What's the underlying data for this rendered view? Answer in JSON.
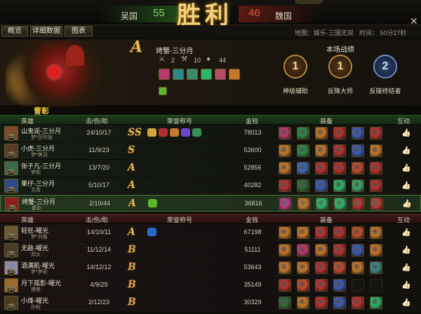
{
  "header": {
    "team_left": "吴国",
    "score_left": "55",
    "team_right": "魏国",
    "score_right": "46",
    "result": "胜利",
    "close_icon": "close-icon"
  },
  "tabs": [
    "概览",
    "详细数据",
    "图表"
  ],
  "meta": {
    "map": "地图：娱乐·三国无双",
    "time": "时间：  50分27秒"
  },
  "hero": {
    "grade": "A",
    "name": "烤蟹-三分月",
    "kills_icon": "swords-icon",
    "kills": "2",
    "assists_icon": "crossed-axes-icon",
    "assists": "10",
    "gold_icon": "gold-pile-icon",
    "gold": "44",
    "title_icon": "honor-badge-icon",
    "player_label": "曹彰"
  },
  "performance": {
    "title": "本场战绩",
    "medals": [
      {
        "label": "神级辅助",
        "mark": "1"
      },
      {
        "label": "反降大师",
        "mark": "1"
      },
      {
        "label": "反陵终结者",
        "mark": "2"
      }
    ]
  },
  "columns": {
    "hero": "英雄",
    "kda": "击/伤/助",
    "honor": "荣誉称号",
    "gold": "金钱",
    "equip": "装备",
    "interact": "互动"
  },
  "team_a": [
    {
      "name": "山鬼谣-三分月",
      "level": "25",
      "player": "梦*莎玲珑",
      "kda": "24/10/17",
      "grade": "SS",
      "gold": "78013",
      "avatar": "#7a4a2a",
      "badges": [
        "#d6a43a",
        "#b82e2e",
        "#c77a2a",
        "#6a4ac8",
        "#3a8a5a"
      ]
    },
    {
      "name": "小虎-三分月",
      "level": "25",
      "player": "梦*美羽",
      "kda": "11/9/23",
      "grade": "S",
      "gold": "53600",
      "avatar": "#5a3a2a",
      "badges": []
    },
    {
      "name": "张子凡-三分月",
      "level": "25",
      "player": "梦莉",
      "kda": "13/7/20",
      "grade": "A",
      "gold": "52856",
      "avatar": "#3a6a4a",
      "badges": []
    },
    {
      "name": "果仔-三分月",
      "level": "25",
      "player": "文青",
      "kda": "5/10/17",
      "grade": "A",
      "gold": "40282",
      "avatar": "#2a4a8a",
      "badges": []
    },
    {
      "name": "烤蟹-三分月",
      "level": "25",
      "player": "曹彰",
      "kda": "2/10/44",
      "grade": "A",
      "gold": "36816",
      "avatar": "#8a2020",
      "badges": [
        "#5ab82a"
      ]
    }
  ],
  "team_b": [
    {
      "name": "轻狂-曜光",
      "level": "25",
      "player": "梦*刘备",
      "kda": "14/10/11",
      "grade": "A",
      "gold": "67198",
      "avatar": "#6a5a3a",
      "badges": [
        "#2a6ac8"
      ]
    },
    {
      "name": "无敌-曜光",
      "level": "25",
      "player": "郑女",
      "kda": "11/12/14",
      "grade": "B",
      "gold": "51111",
      "avatar": "#4a3a2a",
      "badges": []
    },
    {
      "name": "酒满肌-曜光",
      "level": "25",
      "player": "梦*梦莉",
      "kda": "14/12/12",
      "grade": "B",
      "gold": "53643",
      "avatar": "#8a8aa8",
      "badges": []
    },
    {
      "name": "月下孤影-曜光",
      "level": "25",
      "player": "狸景",
      "kda": "4/9/29",
      "grade": "B",
      "gold": "35149",
      "avatar": "#9a6a2a",
      "badges": []
    },
    {
      "name": "小烽-曜光",
      "level": "25",
      "player": "孙权",
      "kda": "2/12/23",
      "grade": "B",
      "gold": "30329",
      "avatar": "#4a3a22",
      "badges": []
    }
  ],
  "equip_colors_a": [
    [
      "#b83a6a",
      "#2a8a4a",
      "#c8782a",
      "#b8302a",
      "#3a5ab8",
      "#b83030"
    ],
    [
      "#c8782a",
      "#2a8a4a",
      "#c8782a",
      "#b83030",
      "#3a5ab8",
      "#c8782a"
    ],
    [
      "#c8782a",
      "#3a6ab8",
      "#b83030",
      "#b83030",
      "#c84a2a",
      "#b83030"
    ],
    [
      "#b83030",
      "#2a6a3a",
      "#3a5ab8",
      "#2ab86a",
      "#3aa86a",
      "#b83030"
    ],
    [
      "#b83a8a",
      "#c8782a",
      "#2ab86a",
      "#2ab86a",
      "#b83030",
      "#b83a3a"
    ]
  ],
  "equip_colors_b": [
    [
      "#c8782a",
      "#c8782a",
      "#b83030",
      "#b83030",
      "#c84a2a",
      "#c8782a"
    ],
    [
      "#c8782a",
      "#b83a6a",
      "#c8782a",
      "#b83030",
      "#3a5ab8",
      "#c8782a"
    ],
    [
      "#c8782a",
      "#c8782a",
      "#b83030",
      "#c84a2a",
      "#c8782a",
      "#3a8a8a"
    ],
    [
      "#b83030",
      "#c84a2a",
      "#b83030",
      "#3a5ab8",
      "empty",
      "empty"
    ],
    [
      "#2a6a3a",
      "#c8782a",
      "#b83030",
      "#3a5ab8",
      "#b83030",
      "#2ab86a"
    ]
  ],
  "hero_items": [
    "#b83a6a",
    "#2a8a8a",
    "#3a8a6a",
    "#2ab86a",
    "#b84a6a",
    "#c8782a"
  ]
}
